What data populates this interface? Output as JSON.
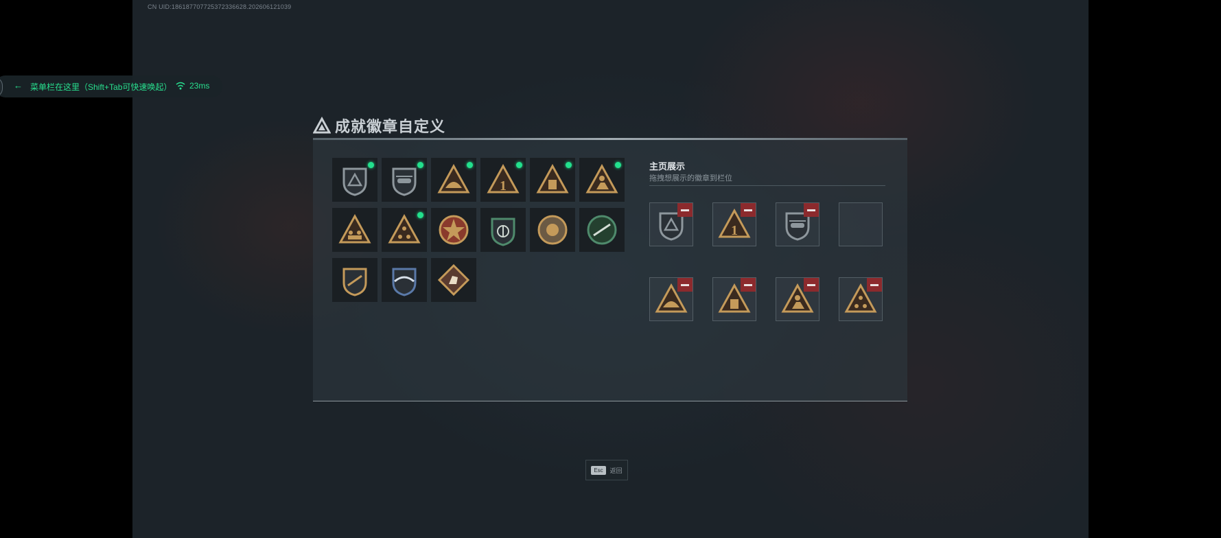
{
  "uid_text": "CN UID:186187707725372336628.202606121039",
  "menu": {
    "text": "菜单栏在这里（Shift+Tab可快速唤起）",
    "ping": "23ms",
    "arrow_icon": "arrow-left-icon",
    "wifi_icon": "wifi-icon"
  },
  "dialog": {
    "title": "成就徽章自定义",
    "title_icon": "triangle-logo-icon",
    "display_title": "主页展示",
    "display_subtitle": "拖拽想展示的徽章到栏位"
  },
  "colors": {
    "accent_green": "#22e08d",
    "remove_red": "#8c2a2d",
    "badge_gold": "#c49a5a"
  },
  "badges": [
    {
      "icon": "shield-triangle-badge-icon",
      "selected": true
    },
    {
      "icon": "shield-helicopter-badge-icon",
      "selected": true
    },
    {
      "icon": "triangle-helmet-badge-icon",
      "selected": true
    },
    {
      "icon": "triangle-number-one-badge-icon",
      "selected": true
    },
    {
      "icon": "triangle-box-badge-icon",
      "selected": true
    },
    {
      "icon": "triangle-soldier-badge-icon",
      "selected": true
    },
    {
      "icon": "triangle-squad-badge-icon",
      "selected": false
    },
    {
      "icon": "triangle-dots-badge-icon",
      "selected": true
    },
    {
      "icon": "star-emblem-badge-icon",
      "selected": false
    },
    {
      "icon": "green-shield-badge-icon",
      "selected": false
    },
    {
      "icon": "round-emblem-badge-icon",
      "selected": false
    },
    {
      "icon": "green-rifle-badge-icon",
      "selected": false
    },
    {
      "icon": "shield-rifle-badge-icon",
      "selected": false
    },
    {
      "icon": "blue-wings-badge-icon",
      "selected": false
    },
    {
      "icon": "diamond-horse-badge-icon",
      "selected": false
    }
  ],
  "display_slots": [
    {
      "icon": "shield-triangle-badge-icon",
      "filled": true
    },
    {
      "icon": "triangle-number-one-badge-icon",
      "filled": true
    },
    {
      "icon": "shield-helicopter-badge-icon",
      "filled": true
    },
    {
      "icon": "empty-slot",
      "filled": false
    },
    {
      "icon": "triangle-helmet-badge-icon",
      "filled": true
    },
    {
      "icon": "triangle-box-badge-icon",
      "filled": true
    },
    {
      "icon": "triangle-soldier-badge-icon",
      "filled": true
    },
    {
      "icon": "triangle-dots-badge-icon",
      "filled": true
    }
  ],
  "footer": {
    "esc_key": "Esc",
    "esc_label": "返回"
  }
}
